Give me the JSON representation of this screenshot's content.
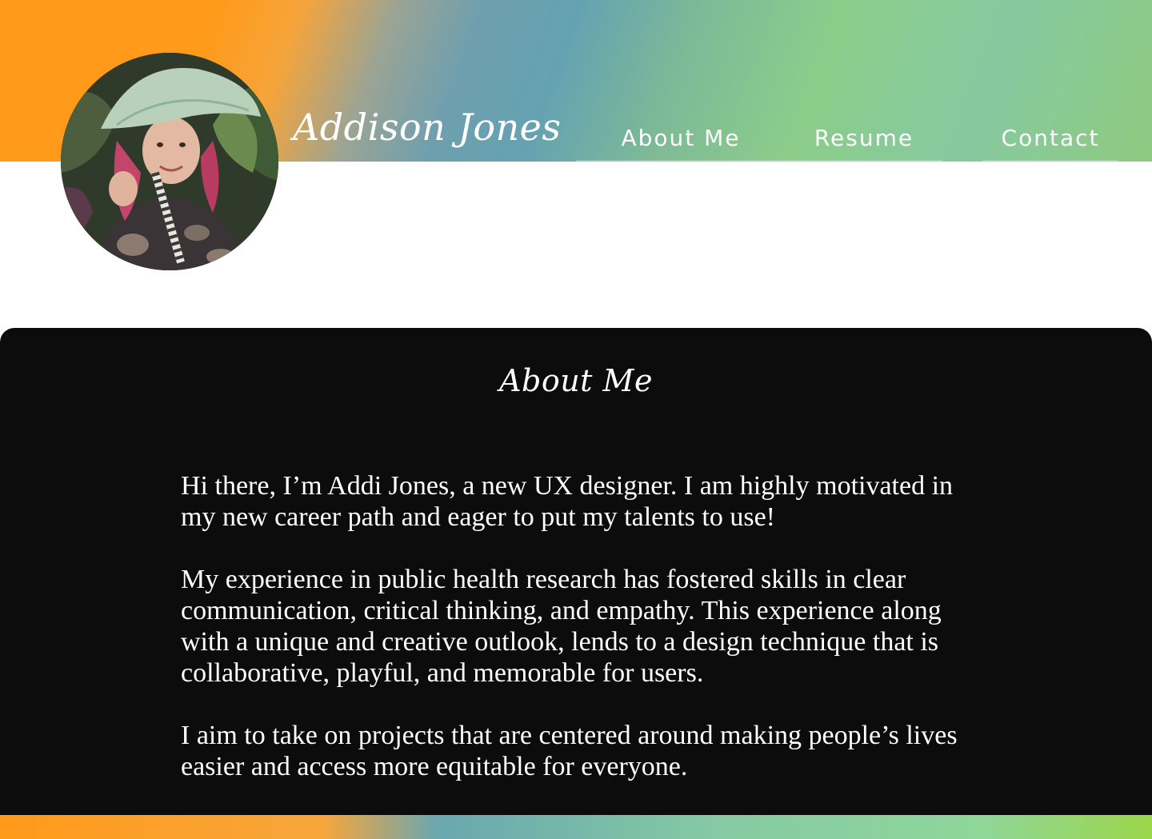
{
  "header": {
    "site_title": "Addison Jones",
    "avatar_alt": "Addison Jones profile photo"
  },
  "nav": {
    "items": [
      {
        "label": "About Me"
      },
      {
        "label": "Resume"
      },
      {
        "label": "Contact"
      }
    ]
  },
  "about": {
    "heading": "About Me",
    "paragraphs": [
      "Hi there, I’m Addi Jones, a new UX designer. I am highly motivated in my new career path and eager to put my talents to use!",
      "My experience in public health research has fostered skills in clear communication, critical thinking, and empathy. This experience along with a unique and creative outlook, lends to a design technique that is collaborative, playful, and memorable for users.",
      "I aim to take on projects that are centered around making people’s lives easier and access more equitable for everyone."
    ]
  },
  "colors": {
    "accent_orange": "#ff9a1a",
    "accent_teal": "#64a2b2",
    "accent_green": "#8ccd8a",
    "panel_background": "#0c0c0c",
    "text_light": "#ffffff"
  }
}
